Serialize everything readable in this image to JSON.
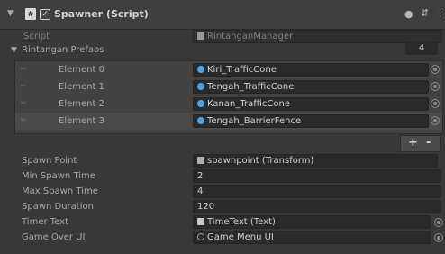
{
  "component": {
    "title": "Spawner (Script)",
    "enabled_check": "✓",
    "script_icon": "#"
  },
  "script_field": {
    "label": "Script",
    "value": "RintanganManager"
  },
  "prefabs_list": {
    "label": "Rintangan Prefabs",
    "count": "4",
    "elements": [
      {
        "label": "Element 0",
        "value": "Kiri_TrafficCone"
      },
      {
        "label": "Element 1",
        "value": "Tengah_TrafficCone"
      },
      {
        "label": "Element 2",
        "value": "Kanan_TrafficCone"
      },
      {
        "label": "Element 3",
        "value": "Tengah_BarrierFence"
      }
    ],
    "add_label": "+",
    "remove_label": "-"
  },
  "properties": [
    {
      "label": "Spawn Point",
      "value": "spawnpoint (Transform)"
    },
    {
      "label": "Min Spawn Time",
      "value": "2"
    },
    {
      "label": "Max Spawn Time",
      "value": "4"
    },
    {
      "label": "Spawn Duration",
      "value": "120"
    },
    {
      "label": "Timer Text",
      "value": "TimeText (Text)"
    },
    {
      "label": "Game Over UI",
      "value": "Game Menu UI"
    }
  ],
  "icons": {
    "help": "❓",
    "presets": "⇵",
    "more": "⋮"
  }
}
